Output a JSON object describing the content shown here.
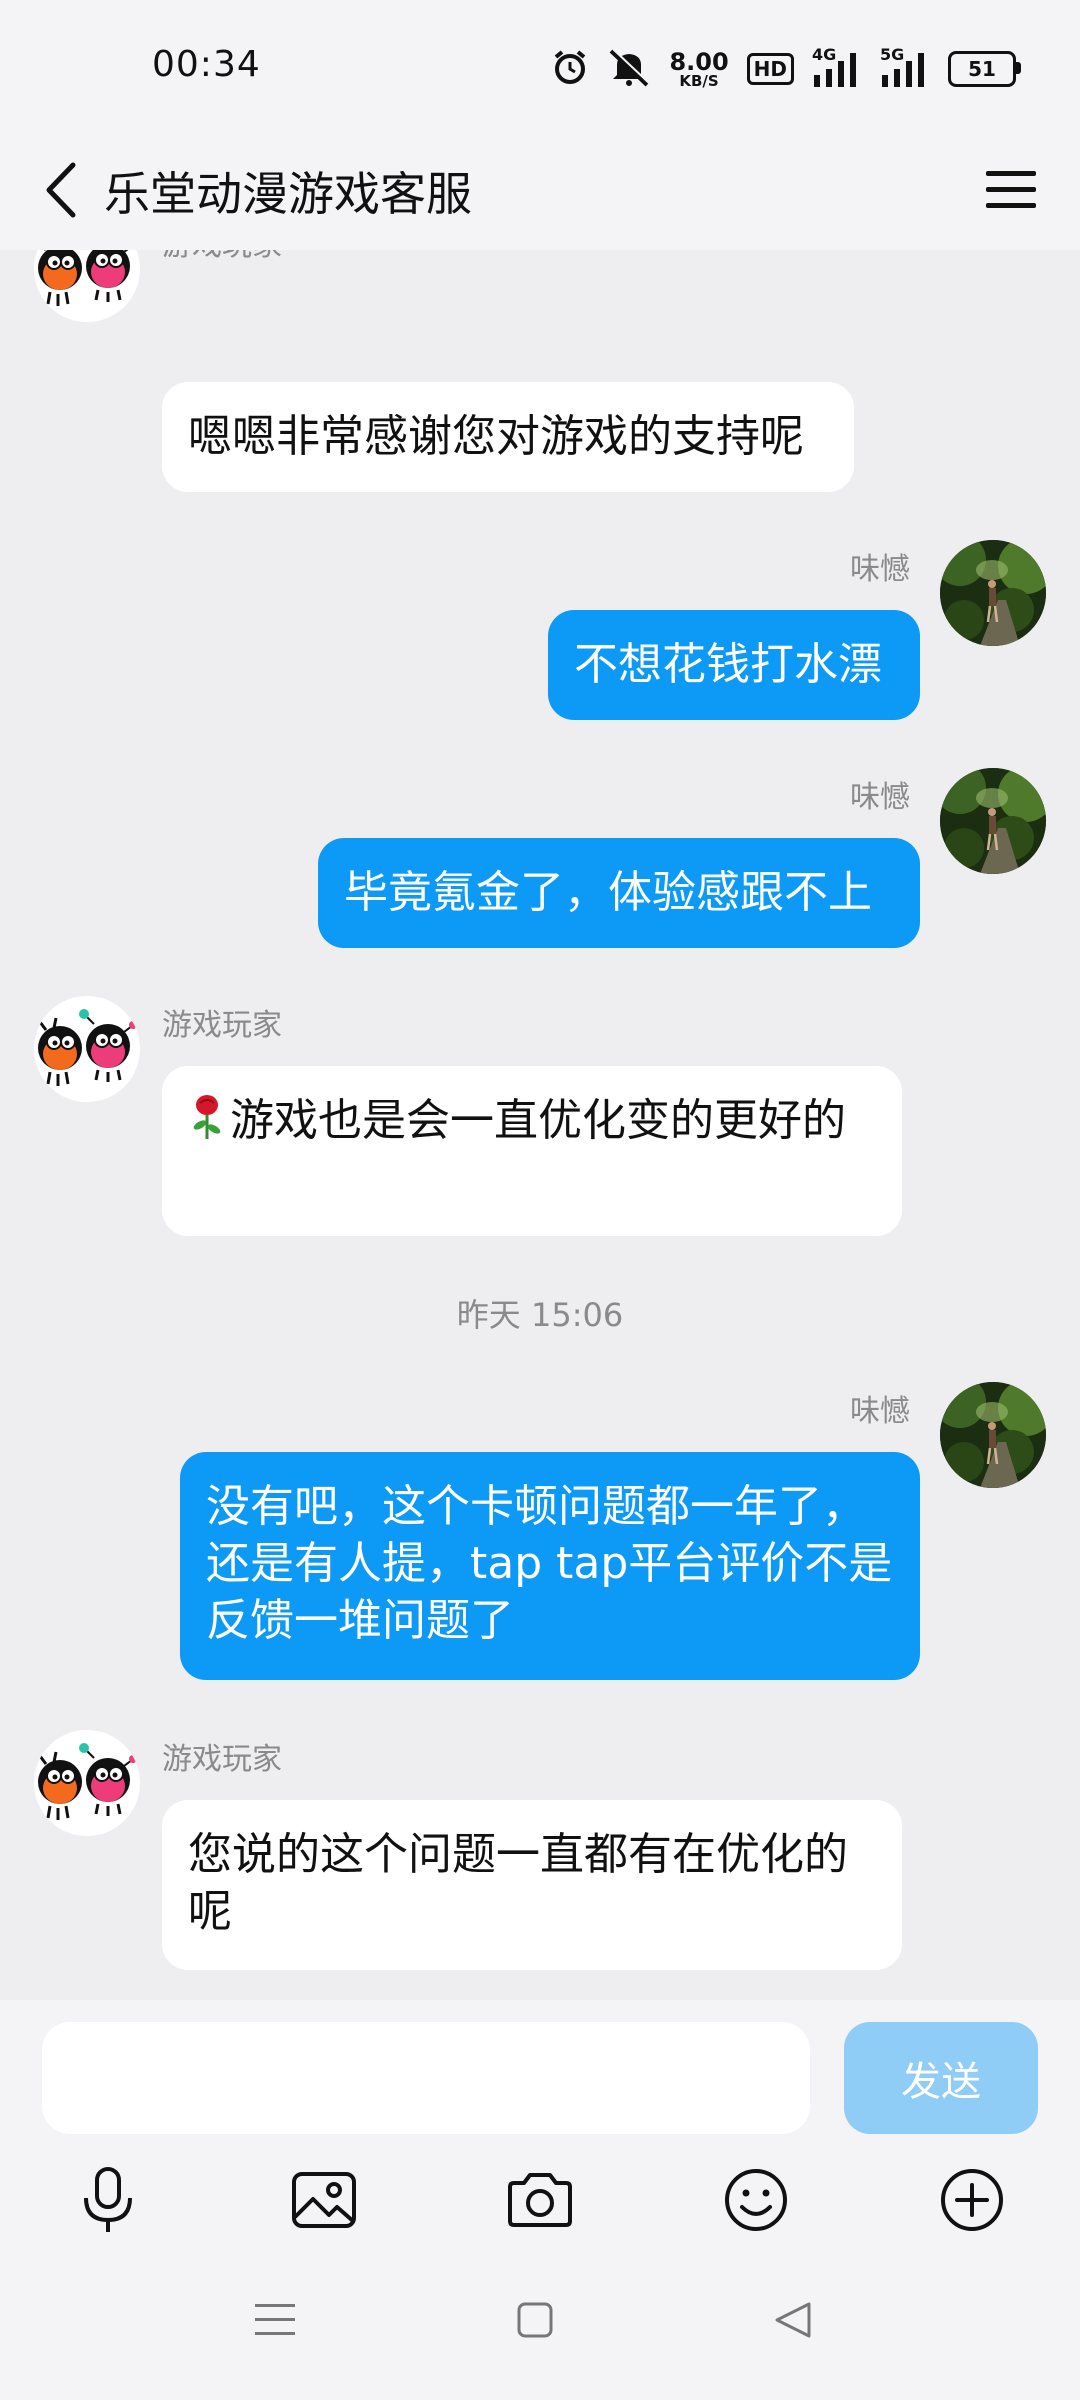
{
  "status_bar": {
    "time": "00:34",
    "net_speed_value": "8.00",
    "net_speed_unit": "KB/S",
    "hd_label": "HD",
    "network_4g": "4G",
    "network_5g": "5G",
    "battery": "51",
    "icons": [
      "alarm-icon",
      "mute-icon",
      "signal-4g-icon",
      "signal-5g-icon",
      "battery-icon"
    ]
  },
  "header": {
    "title": "乐堂动漫游戏客服",
    "icons": [
      "back-icon",
      "menu-icon"
    ]
  },
  "messages": [
    {
      "from": "bot",
      "sender": "游戏玩家",
      "text": "嗯嗯非常感谢您对游戏的支持呢"
    },
    {
      "from": "user",
      "sender": "味憾",
      "text": "不想花钱打水漂"
    },
    {
      "from": "user",
      "sender": "味憾",
      "text": "毕竟氪金了，体验感跟不上"
    },
    {
      "from": "bot",
      "sender": "游戏玩家",
      "emoji": "rose-icon",
      "text": "游戏也是会一直优化变的更好的"
    },
    {
      "timestamp": "昨天 15:06"
    },
    {
      "from": "user",
      "sender": "味憾",
      "text": "没有吧，这个卡顿问题都一年了，还是有人提，tap tap平台评价不是反馈一堆问题了"
    },
    {
      "from": "bot",
      "sender": "游戏玩家",
      "text": "您说的这个问题一直都有在优化的呢"
    }
  ],
  "input": {
    "value": "",
    "send_label": "发送",
    "tools": [
      "microphone-icon",
      "image-icon",
      "camera-icon",
      "emoji-icon",
      "plus-icon"
    ]
  },
  "nav_bar": {
    "icons": [
      "recent-apps-icon",
      "home-icon",
      "back-triangle-icon"
    ]
  },
  "colors": {
    "outgoing_bubble": "#0d99f6",
    "incoming_bubble": "#ffffff",
    "send_button_disabled": "#8fccf6",
    "background": "#eeeef1"
  }
}
